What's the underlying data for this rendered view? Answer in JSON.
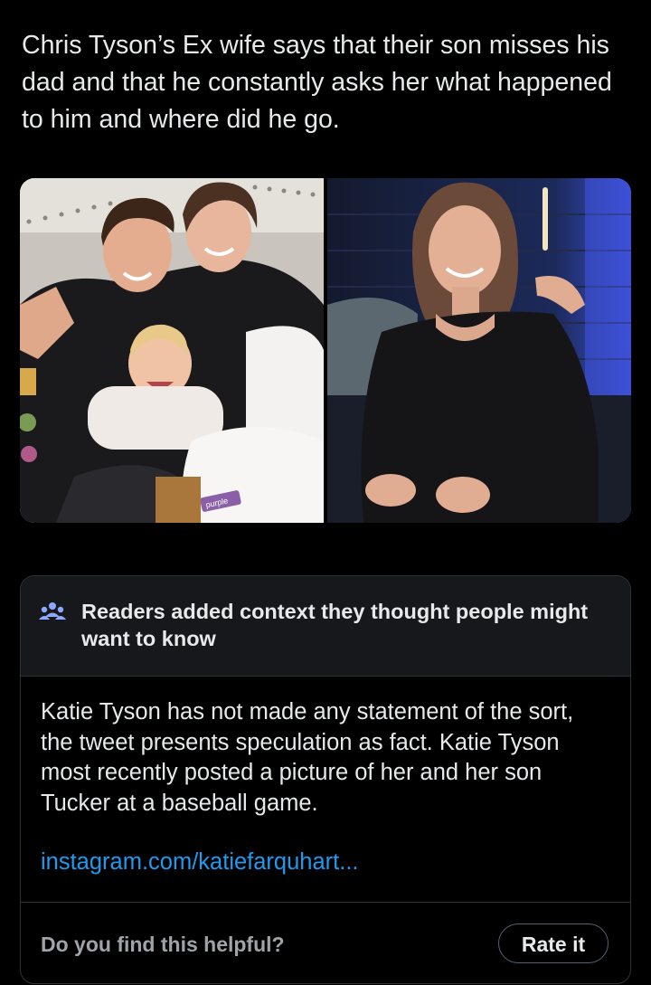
{
  "tweet": {
    "text": "Chris Tyson’s Ex wife says that their son misses his dad and that he constantly asks her what happened to him and where did he go."
  },
  "media": {
    "photo_left": {
      "pillow_brand": "purple"
    }
  },
  "note": {
    "title": "Readers added context they thought people might want to know",
    "body": "Katie Tyson has not made any statement of the sort, the tweet presents speculation as fact. Katie Tyson most recently posted a picture of her and her son Tucker at a baseball game.",
    "link": "instagram.com/katiefarquhart...",
    "helpful_prompt": "Do you find this helpful?",
    "rate_label": "Rate it"
  },
  "colors": {
    "background": "#000000",
    "text": "#e7e9ea",
    "link": "#1d9bf0",
    "note_header_bg": "#16181c",
    "border": "#2f3336",
    "muted": "#a0a4a8",
    "readers_icon": "#8fa8ff"
  },
  "icons": {
    "note_icon": "people-group-icon"
  }
}
